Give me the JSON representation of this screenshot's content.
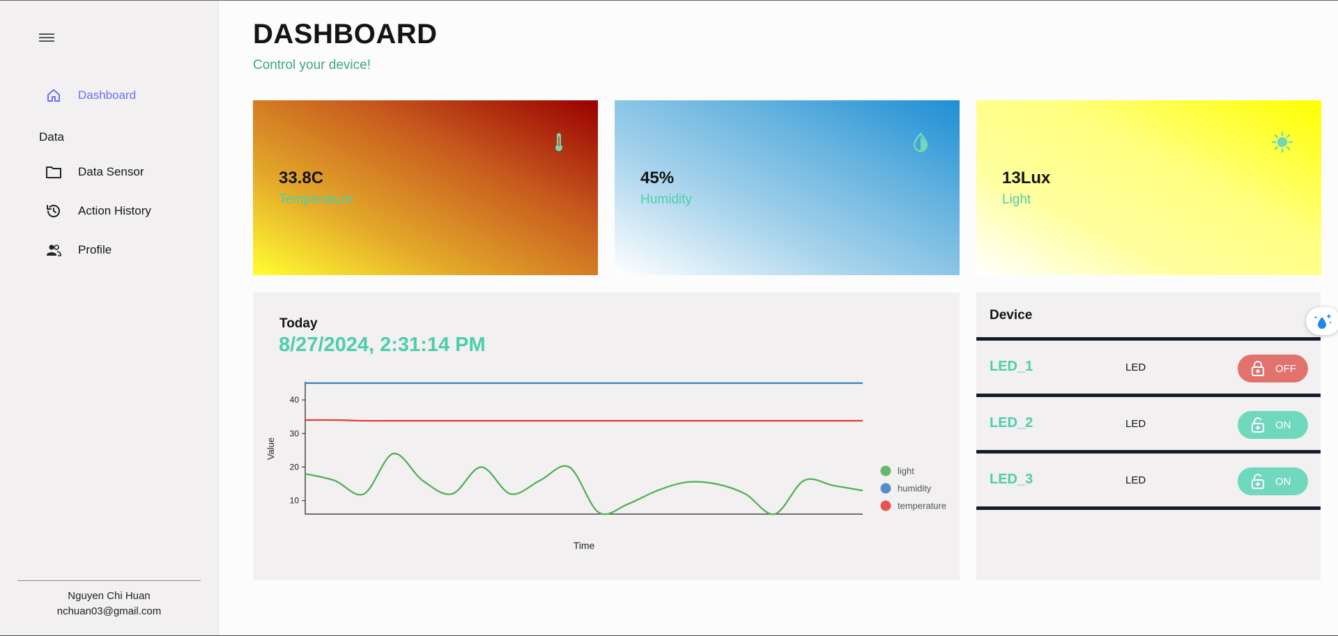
{
  "sidebar": {
    "menu_icon": "hamburger-menu-icon",
    "items": [
      {
        "label": "Dashboard",
        "icon": "home-icon",
        "active": true
      },
      {
        "label": "Data Sensor",
        "icon": "folder-icon",
        "active": false
      },
      {
        "label": "Action History",
        "icon": "history-icon",
        "active": false
      },
      {
        "label": "Profile",
        "icon": "people-icon",
        "active": false
      }
    ],
    "section_label": "Data",
    "user": {
      "name": "Nguyen Chi Huan",
      "email": "nchuan03@gmail.com"
    }
  },
  "header": {
    "title": "DASHBOARD",
    "subtitle": "Control your device!"
  },
  "stats": [
    {
      "value": "33.8C",
      "label": "Temperature",
      "icon": "thermometer-icon"
    },
    {
      "value": "45%",
      "label": "Humidity",
      "icon": "water-drop-icon"
    },
    {
      "value": "13Lux",
      "label": "Light",
      "icon": "sun-icon"
    }
  ],
  "chart_panel": {
    "heading": "Today",
    "datetime": "8/27/2024, 2:31:14 PM"
  },
  "chart_data": {
    "type": "line",
    "xlabel": "Time",
    "ylabel": "Value",
    "yticks": [
      10,
      20,
      30,
      40
    ],
    "ylim": [
      6,
      45
    ],
    "legend_position": "right",
    "series": [
      {
        "name": "light",
        "color": "#4caf50",
        "values": [
          18,
          16,
          12,
          24,
          16,
          12,
          20,
          12,
          16,
          20,
          6.5,
          9,
          13,
          15.5,
          15,
          12,
          6,
          16,
          14.5,
          13
        ]
      },
      {
        "name": "humidity",
        "color": "#3a7dc0",
        "values": [
          45,
          45,
          45,
          45,
          45,
          45,
          45,
          45,
          45,
          45,
          45,
          45,
          45,
          45,
          45,
          45,
          45,
          45,
          45,
          45
        ]
      },
      {
        "name": "temperature",
        "color": "#e53935",
        "values": [
          34,
          34,
          33.8,
          33.8,
          33.8,
          33.8,
          33.8,
          33.8,
          33.8,
          33.8,
          33.8,
          33.8,
          33.8,
          33.8,
          33.8,
          33.8,
          33.8,
          33.8,
          33.8,
          33.8
        ]
      }
    ]
  },
  "devices": {
    "title": "Device",
    "rows": [
      {
        "name": "LED_1",
        "type": "LED",
        "state": "OFF",
        "status": "off",
        "color": "#e2726e"
      },
      {
        "name": "LED_2",
        "type": "LED",
        "state": "ON",
        "status": "on",
        "color": "#70d8bd"
      },
      {
        "name": "LED_3",
        "type": "LED",
        "state": "ON",
        "status": "on",
        "color": "#70d8bd"
      }
    ]
  },
  "floating_button": {
    "icon": "sparkle-water-icon"
  },
  "colors": {
    "accent_green": "#4cceac",
    "accent_blue": "#6870fa",
    "subtitle_green": "#3da58a",
    "separator": "#141b2d"
  }
}
